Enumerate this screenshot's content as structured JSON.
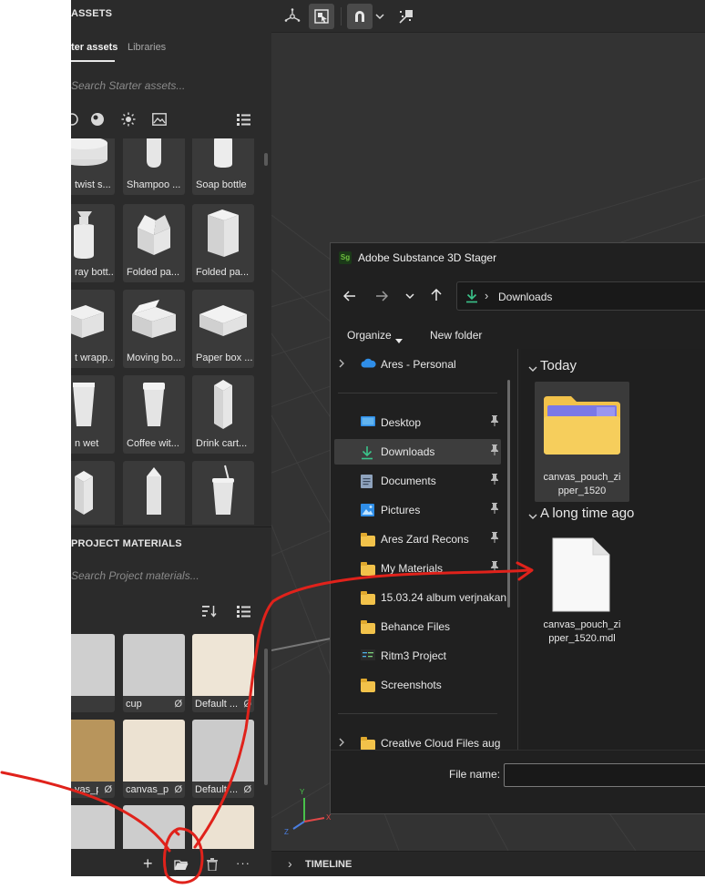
{
  "left_panel": {
    "assets_title": "ASSETS",
    "tabs": [
      {
        "label": "ter assets",
        "active": true
      },
      {
        "label": "Libraries",
        "active": false
      }
    ],
    "search_placeholder": "Search Starter assets...",
    "asset_rows": [
      [
        "twist s...",
        "Shampoo ...",
        "Soap bottle"
      ],
      [
        "ray bott...",
        "Folded pa...",
        "Folded pa..."
      ],
      [
        "t wrapp...",
        "Moving bo...",
        "Paper box ..."
      ],
      [
        "n wet",
        "Coffee wit...",
        "Drink cart..."
      ],
      [
        "",
        "",
        ""
      ]
    ],
    "project_materials_title": "PROJECT MATERIALS",
    "materials_search_placeholder": "Search Project materials...",
    "materials": [
      {
        "label": "",
        "null_mark": ""
      },
      {
        "label": "cup",
        "null_mark": "Ø"
      },
      {
        "label": "Default ...",
        "null_mark": "Ø"
      },
      {
        "label": "vas_p...",
        "null_mark": "Ø"
      },
      {
        "label": "canvas_p...",
        "null_mark": "Ø"
      },
      {
        "label": "Default ...",
        "null_mark": "Ø"
      },
      {
        "label": "",
        "null_mark": ""
      },
      {
        "label": "",
        "null_mark": ""
      },
      {
        "label": "",
        "null_mark": ""
      }
    ],
    "bottom_actions": {
      "add": "+",
      "more": "···"
    }
  },
  "timeline": {
    "label": "TIMELINE",
    "chevron": "›"
  },
  "dialog": {
    "app_badge": "Sg",
    "title": "Adobe Substance 3D Stager",
    "address": {
      "separator": "›",
      "location": "Downloads"
    },
    "commands": {
      "organize": "Organize",
      "new_folder": "New folder"
    },
    "nav_items": [
      {
        "label": "Ares - Personal",
        "icon": "cloud-icon",
        "pinned": false,
        "selected": false,
        "expand": true
      },
      {
        "label": "Desktop",
        "icon": "desktop-icon",
        "pinned": true,
        "selected": false,
        "expand": false
      },
      {
        "label": "Downloads",
        "icon": "download-icon",
        "pinned": true,
        "selected": true,
        "expand": false
      },
      {
        "label": "Documents",
        "icon": "document-icon",
        "pinned": true,
        "selected": false,
        "expand": false
      },
      {
        "label": "Pictures",
        "icon": "pictures-icon",
        "pinned": true,
        "selected": false,
        "expand": false
      },
      {
        "label": "Ares Zard Recons",
        "icon": "folder-icon",
        "pinned": true,
        "selected": false,
        "expand": false
      },
      {
        "label": "My Materials",
        "icon": "folder-icon",
        "pinned": true,
        "selected": false,
        "expand": false
      },
      {
        "label": "15.03.24 album verjnakan",
        "icon": "folder-icon",
        "pinned": false,
        "selected": false,
        "expand": false
      },
      {
        "label": "Behance Files",
        "icon": "folder-icon",
        "pinned": false,
        "selected": false,
        "expand": false
      },
      {
        "label": "Ritm3 Project",
        "icon": "project-icon",
        "pinned": false,
        "selected": false,
        "expand": false
      },
      {
        "label": "Screenshots",
        "icon": "folder-icon",
        "pinned": false,
        "selected": false,
        "expand": false
      },
      {
        "label": "Creative Cloud Files  aug",
        "icon": "folder-icon",
        "pinned": false,
        "selected": false,
        "expand": true
      }
    ],
    "groups": {
      "today": "Today",
      "long_ago": "A long time ago"
    },
    "files": [
      {
        "line1": "canvas_pouch_zi",
        "line2": "pper_1520",
        "type": "folder"
      },
      {
        "line1": "canvas_pouch_zi",
        "line2": "pper_1520.mdl",
        "type": "file"
      }
    ],
    "file_name_label": "File name:",
    "file_name_value": ""
  },
  "colors": {
    "panel_bg": "#2b2b2b",
    "viewport_bg": "#333333",
    "dialog_bg": "#202020",
    "selection": "#3d3d3d",
    "annotation": "#e0221b",
    "accent_green": "#3bc48b",
    "folder_yellow": "#f2c24a",
    "badge_green": "#6fc13f"
  }
}
